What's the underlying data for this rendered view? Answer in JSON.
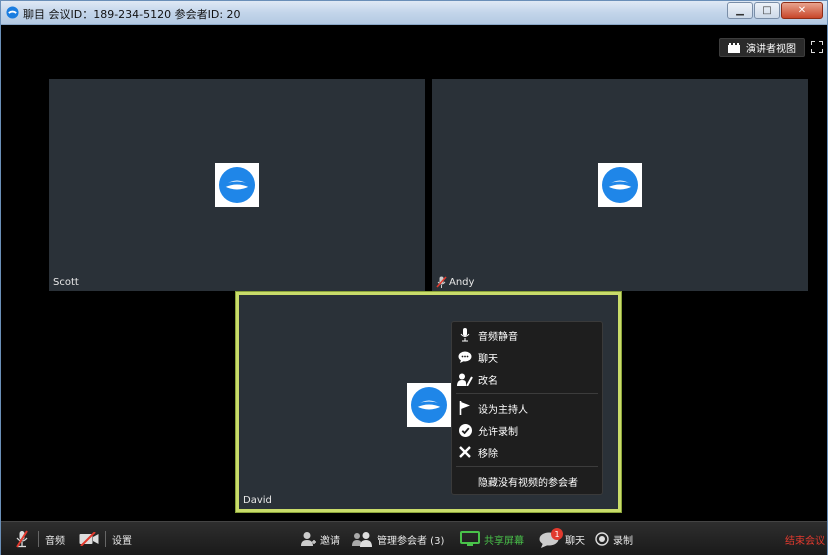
{
  "window": {
    "title": "聊目 会议ID：189-234-5120 参会者ID: 20",
    "minimize_icon": "minimize-icon",
    "maximize_icon": "maximize-icon",
    "close_icon": "close-icon"
  },
  "header": {
    "speaker_view_label": "演讲者视图",
    "fullscreen_icon": "fullscreen-icon"
  },
  "participants": [
    {
      "name": "Scott",
      "muted": false
    },
    {
      "name": "Andy",
      "muted": true
    },
    {
      "name": "David",
      "muted": false,
      "active": true
    }
  ],
  "context_menu": {
    "items": [
      {
        "label": "音频静音",
        "icon": "microphone-icon"
      },
      {
        "label": "聊天",
        "icon": "chat-icon"
      },
      {
        "label": "改名",
        "icon": "rename-icon"
      },
      {
        "label": "设为主持人",
        "icon": "flag-icon"
      },
      {
        "label": "允许录制",
        "icon": "check-icon"
      },
      {
        "label": "移除",
        "icon": "remove-icon"
      },
      {
        "label": "隐藏没有视频的参会者",
        "icon": ""
      }
    ]
  },
  "toolbar": {
    "audio_label": "音频",
    "settings_label": "设置",
    "invite_label": "邀请",
    "manage_label": "管理参会者 (3)",
    "share_label": "共享屏幕",
    "chat_label": "聊天",
    "chat_badge": "1",
    "record_label": "录制",
    "end_label": "结束会议"
  },
  "colors": {
    "active_border": "#c9dc6a",
    "share_green": "#49c24a",
    "end_red": "#e23a2e",
    "tile_bg": "#2a3138"
  }
}
